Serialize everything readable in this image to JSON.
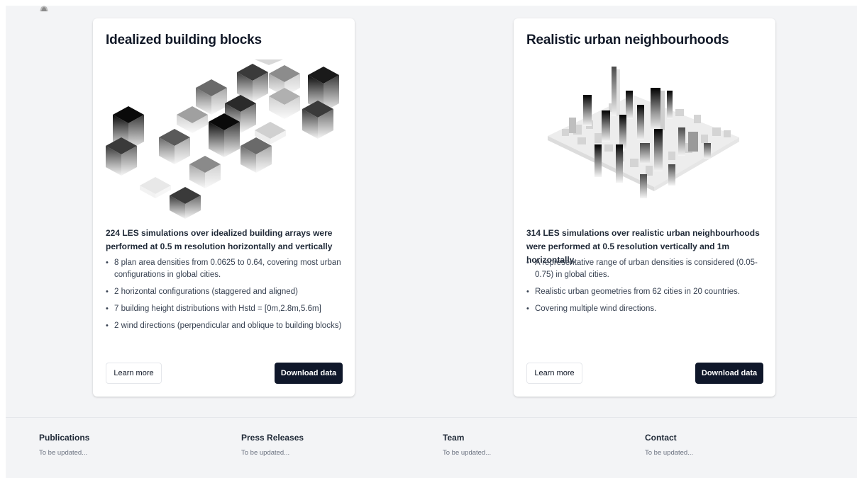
{
  "cards": [
    {
      "title": "Idealized building blocks",
      "summary": "224 LES simulations over idealized building arrays were performed at 0.5 m resolution horizontally and vertically",
      "bullets": [
        "8 plan area densities from 0.0625 to 0.64, covering most urban configurations in global cities.",
        "2 horizontal configurations (staggered and aligned)",
        "7 building height distributions with Hstd = [0m,2.8m,5.6m]",
        "2 wind directions (perpendicular and oblique to building blocks)"
      ],
      "learn_more_label": "Learn more",
      "download_label": "Download data"
    },
    {
      "title": "Realistic urban neighbourhoods",
      "summary": "314 LES simulations over realistic urban neighbourhoods were performed at 0.5 resolution vertically and 1m horizontally.",
      "bullets": [
        "A representative range of urban densities is considered (0.05-0.75) in global cities.",
        "Realistic urban geometries from 62 cities in 20 countries.",
        "Covering multiple wind directions."
      ],
      "learn_more_label": "Learn more",
      "download_label": "Download data"
    }
  ],
  "footer": {
    "columns": [
      {
        "title": "Publications",
        "text": "To be updated..."
      },
      {
        "title": "Press Releases",
        "text": "To be updated..."
      },
      {
        "title": "Team",
        "text": "To be updated..."
      },
      {
        "title": "Contact",
        "text": "To be updated..."
      }
    ]
  },
  "colors": {
    "background": "#f3f4f6",
    "card": "#ffffff",
    "primary_button": "#0f172a"
  },
  "icons": {
    "bullet": "•"
  }
}
